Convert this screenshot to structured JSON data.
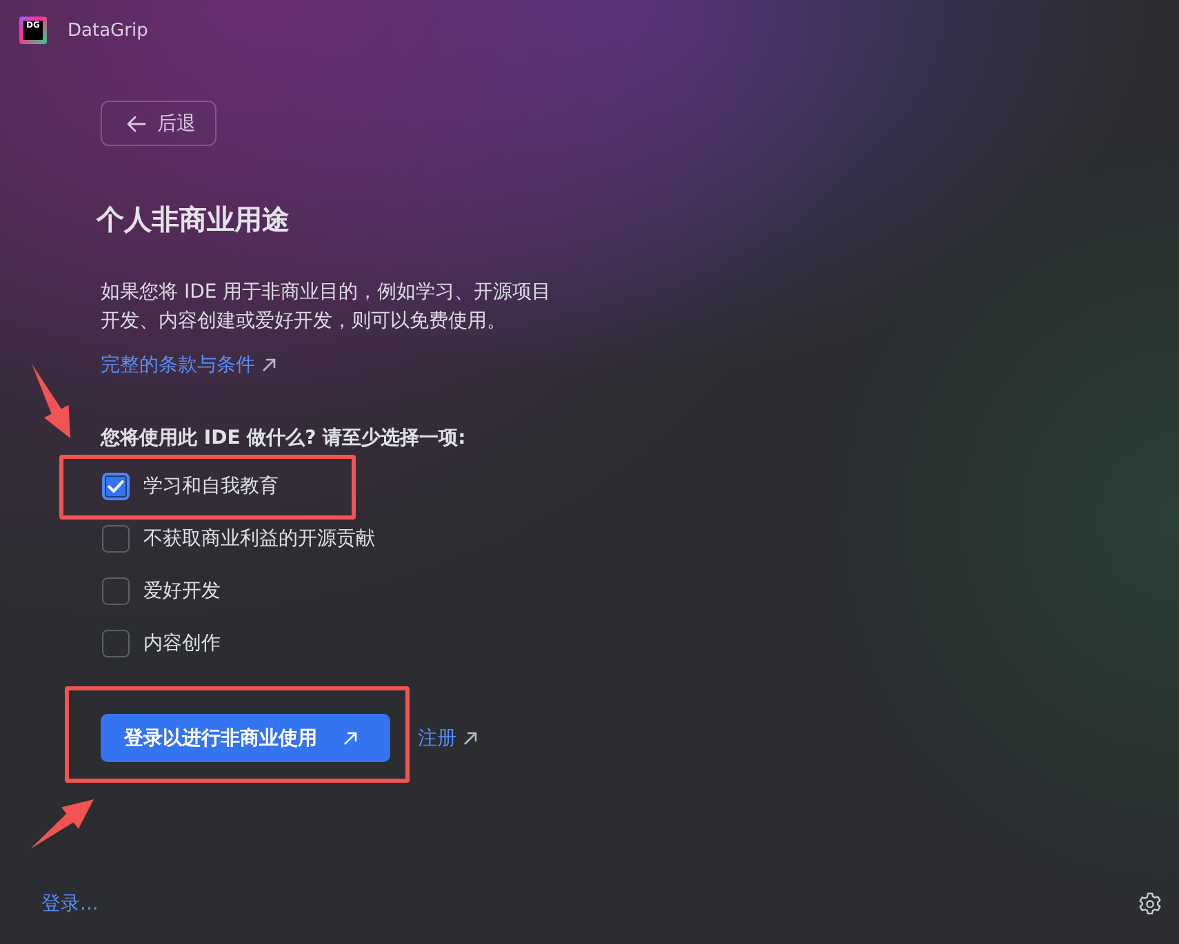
{
  "window": {
    "title": "DataGrip",
    "logo_text": "DG"
  },
  "back_button": {
    "label": "后退"
  },
  "heading": "个人非商业用途",
  "description": "如果您将 IDE 用于非商业目的，例如学习、开源项目开发、内容创建或爱好开发，则可以免费使用。",
  "terms_link": {
    "label": "完整的条款与条件"
  },
  "question": "您将使用此 IDE 做什么? 请至少选择一项:",
  "options": [
    {
      "label": "学习和自我教育",
      "checked": true,
      "highlighted": true
    },
    {
      "label": "不获取商业利益的开源贡献",
      "checked": false,
      "highlighted": false
    },
    {
      "label": "爱好开发",
      "checked": false,
      "highlighted": false
    },
    {
      "label": "内容创作",
      "checked": false,
      "highlighted": false
    }
  ],
  "primary_button": {
    "label": "登录以进行非商业使用",
    "highlighted": true
  },
  "register_link": {
    "label": "注册"
  },
  "footer": {
    "login_link": "登录..."
  }
}
